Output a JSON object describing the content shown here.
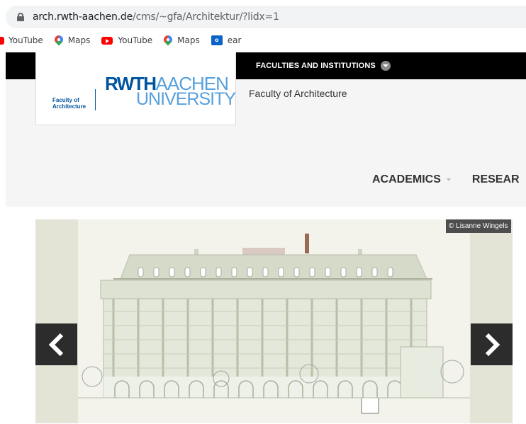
{
  "browser": {
    "url_domain": "arch.rwth-aachen.de",
    "url_path": "/cms/~gfa/Architektur/?lidx=1"
  },
  "bookmarks": [
    {
      "label": "YouTube",
      "icon": "youtube-icon"
    },
    {
      "label": "Maps",
      "icon": "maps-icon"
    },
    {
      "label": "YouTube",
      "icon": "youtube-icon"
    },
    {
      "label": "Maps",
      "icon": "maps-icon"
    },
    {
      "label": "ear",
      "icon": "outlook-icon"
    }
  ],
  "header": {
    "faculties_menu": "FACULTIES AND INSTITUTIONS",
    "logo_faculty_line1": "Faculty of",
    "logo_faculty_line2": "Architecture",
    "logo_rwth": "RWTH",
    "logo_aachen": "AACHEN",
    "logo_university": "UNIVERSITY",
    "site_name": "Faculty of Architecture"
  },
  "nav": {
    "academics": "ACADEMICS",
    "research": "RESEAR"
  },
  "hero": {
    "credit": "© Lisanne Wingels",
    "colors": {
      "background": "#f3f3ec",
      "sidebars": "#e3e3d6",
      "building": "#d6dccb"
    }
  }
}
